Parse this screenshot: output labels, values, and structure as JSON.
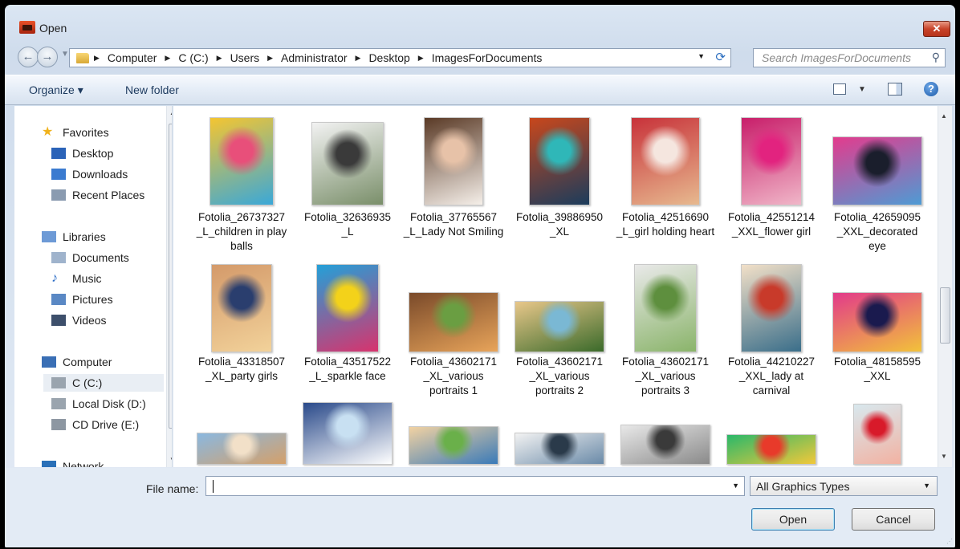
{
  "window": {
    "title": "Open",
    "close_glyph": "✕"
  },
  "address": {
    "crumbs": [
      "Computer",
      "C (C:)",
      "Users",
      "Administrator",
      "Desktop",
      "ImagesForDocuments"
    ],
    "search_placeholder": "Search ImagesForDocuments"
  },
  "toolbar": {
    "organize": "Organize ▾",
    "new_folder": "New folder",
    "help": "?"
  },
  "nav": {
    "items": [
      {
        "label": "Favorites",
        "icon": "star-icon",
        "color": "#f0b21c"
      },
      {
        "label": "Desktop",
        "icon": "desktop-icon",
        "color": "#2b63b8"
      },
      {
        "label": "Downloads",
        "icon": "downloads-icon",
        "color": "#3b7bd0"
      },
      {
        "label": "Recent Places",
        "icon": "recent-places-icon",
        "color": "#8a9bb0"
      },
      {
        "label": "Libraries",
        "icon": "libraries-icon",
        "color": "#6d9ad6"
      },
      {
        "label": "Documents",
        "icon": "documents-icon",
        "color": "#9fb3cc"
      },
      {
        "label": "Music",
        "icon": "music-icon",
        "color": "#2f6fc7"
      },
      {
        "label": "Pictures",
        "icon": "pictures-icon",
        "color": "#5a88c4"
      },
      {
        "label": "Videos",
        "icon": "videos-icon",
        "color": "#3d4f6b"
      },
      {
        "label": "Computer",
        "icon": "computer-icon",
        "color": "#3a6fb5"
      },
      {
        "label": "C (C:)",
        "icon": "drive-icon",
        "color": "#9aa4ae"
      },
      {
        "label": "Local Disk (D:)",
        "icon": "drive-icon",
        "color": "#9aa4ae"
      },
      {
        "label": "CD Drive (E:)",
        "icon": "cd-drive-icon",
        "color": "#8d97a2"
      },
      {
        "label": "Network",
        "icon": "network-icon",
        "color": "#2a70b8"
      }
    ]
  },
  "files": [
    {
      "caption": "Fotolia_26737327 _L_children in play balls",
      "colors": [
        "#e84f7a",
        "#f4c531",
        "#3aa8d8"
      ]
    },
    {
      "caption": "Fotolia_32636935 _L",
      "colors": [
        "#3a3a3a",
        "#f2f2f2",
        "#7a8f6a"
      ]
    },
    {
      "caption": "Fotolia_37765567 _L_Lady Not Smiling",
      "colors": [
        "#e7c2a8",
        "#5a3a26",
        "#f5efe9"
      ]
    },
    {
      "caption": "Fotolia_39886950 _XL",
      "colors": [
        "#2fb7b8",
        "#c8471c",
        "#1b3c5c"
      ]
    },
    {
      "caption": "Fotolia_42516690 _L_girl holding heart",
      "colors": [
        "#f5e6df",
        "#c8323a",
        "#e7b98f"
      ]
    },
    {
      "caption": "Fotolia_42551214 _XXL_flower girl",
      "colors": [
        "#e2237f",
        "#c81e6a",
        "#f0b6c8"
      ]
    },
    {
      "caption": "Fotolia_42659095 _XXL_decorated eye",
      "colors": [
        "#1a1e2c",
        "#e33b8d",
        "#4e9bd4"
      ]
    },
    {
      "caption": "Fotolia_43318507 _XL_party girls",
      "colors": [
        "#2a3e6e",
        "#d49a6a",
        "#f2d29a"
      ]
    },
    {
      "caption": "Fotolia_43517522 _L_sparkle face",
      "colors": [
        "#f3d21a",
        "#23a0d8",
        "#d8336d"
      ]
    },
    {
      "caption": "Fotolia_43602171 _XL_various portraits 1",
      "colors": [
        "#6a9e42",
        "#7a4a2a",
        "#e8a45a"
      ]
    },
    {
      "caption": "Fotolia_43602171 _XL_various portraits 2",
      "colors": [
        "#7ab8d4",
        "#e8c78a",
        "#3a6a2a"
      ]
    },
    {
      "caption": "Fotolia_43602171 _XL_various portraits 3",
      "colors": [
        "#5e8f3e",
        "#e9e9e9",
        "#8ab46a"
      ]
    },
    {
      "caption": "Fotolia_44210227 _XXL_lady at carnival",
      "colors": [
        "#c83a2a",
        "#f2e0c8",
        "#3a6e8a"
      ]
    },
    {
      "caption": "Fotolia_48158595 _XXL",
      "colors": [
        "#1a1a4e",
        "#e23a8a",
        "#f2c23a"
      ]
    },
    {
      "caption": "",
      "colors": [
        "#f2e0c8",
        "#8ab8e0",
        "#d4a06a"
      ]
    },
    {
      "caption": "",
      "colors": [
        "#c8e0f2",
        "#2a4a8a",
        "#ffffff"
      ]
    },
    {
      "caption": "",
      "colors": [
        "#6ab04a",
        "#f2d2a2",
        "#3a7ab8"
      ]
    },
    {
      "caption": "",
      "colors": [
        "#2a3a4a",
        "#f2f2f2",
        "#6a8aa8"
      ]
    },
    {
      "caption": "",
      "colors": [
        "#3a3a3a",
        "#e8e8e8",
        "#8a8a8a"
      ]
    },
    {
      "caption": "",
      "colors": [
        "#e83a2a",
        "#2ab86a",
        "#f2c83a"
      ]
    },
    {
      "caption": "",
      "colors": [
        "#d81a2a",
        "#d8e8ee",
        "#f2b2a2"
      ]
    }
  ],
  "bottom": {
    "file_name_label": "File name:",
    "file_name_value": "",
    "file_type": "All Graphics Types",
    "open_label": "Open",
    "cancel_label": "Cancel"
  }
}
